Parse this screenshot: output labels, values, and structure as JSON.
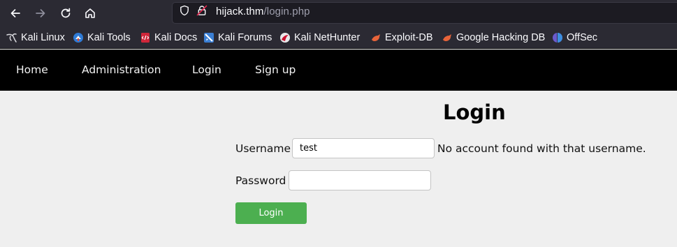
{
  "browser": {
    "url_host": "hijack.thm",
    "url_path": "/login.php",
    "bookmarks": [
      {
        "label": "Kali Linux",
        "icon": "kali-dragon-icon"
      },
      {
        "label": "Kali Tools",
        "icon": "kali-tools-icon"
      },
      {
        "label": "Kali Docs",
        "icon": "kali-docs-icon"
      },
      {
        "label": "Kali Forums",
        "icon": "kali-forums-icon"
      },
      {
        "label": "Kali NetHunter",
        "icon": "kali-nethunter-icon"
      },
      {
        "label": "Exploit-DB",
        "icon": "exploit-db-icon"
      },
      {
        "label": "Google Hacking DB",
        "icon": "google-hacking-db-icon"
      },
      {
        "label": "OffSec",
        "icon": "offsec-icon"
      }
    ]
  },
  "site_nav": {
    "items": [
      "Home",
      "Administration",
      "Login",
      "Sign up"
    ]
  },
  "login": {
    "title": "Login",
    "username_label": "Username",
    "username_value": "test",
    "error_message": "No account found with that username.",
    "password_label": "Password",
    "password_value": "",
    "submit_label": "Login"
  },
  "colors": {
    "toolbar": "#2b2a33",
    "urlbar": "#1c1b22",
    "site_nav_bg": "#000000",
    "page_bg": "#efefef",
    "submit_button": "#4caf50"
  }
}
